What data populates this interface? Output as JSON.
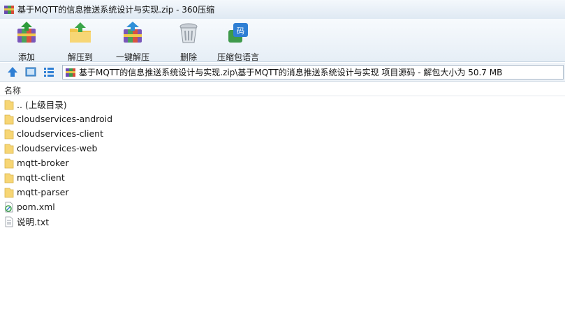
{
  "window": {
    "title": "基于MQTT的信息推送系统设计与实现.zip - 360压缩",
    "icon": "archive-icon"
  },
  "toolbar": {
    "buttons": [
      {
        "label": "添加",
        "icon": "add-archive-icon"
      },
      {
        "label": "解压到",
        "icon": "extract-folder-icon"
      },
      {
        "label": "一键解压",
        "icon": "quick-extract-icon"
      },
      {
        "label": "删除",
        "icon": "trash-bin-icon"
      },
      {
        "label": "压缩包语言",
        "icon": "language-code-icon"
      }
    ]
  },
  "addressbar": {
    "nav_icons": [
      "up-arrow-icon",
      "view-toggle-icon",
      "list-view-icon"
    ],
    "path": "基于MQTT的信息推送系统设计与实现.zip\\基于MQTT的消息推送系统设计与实现 项目源码 - 解包大小为 50.7 MB"
  },
  "list": {
    "column_name": "名称",
    "items": [
      {
        "name": ".. (上级目录)",
        "type": "folder"
      },
      {
        "name": "cloudservices-android",
        "type": "folder"
      },
      {
        "name": "cloudservices-client",
        "type": "folder"
      },
      {
        "name": "cloudservices-web",
        "type": "folder"
      },
      {
        "name": "mqtt-broker",
        "type": "folder"
      },
      {
        "name": "mqtt-client",
        "type": "folder"
      },
      {
        "name": "mqtt-parser",
        "type": "folder"
      },
      {
        "name": "pom.xml",
        "type": "xml"
      },
      {
        "name": "说明.txt",
        "type": "txt"
      }
    ]
  },
  "colors": {
    "folder": "#f7d675",
    "accent": "#2f7fd4"
  }
}
